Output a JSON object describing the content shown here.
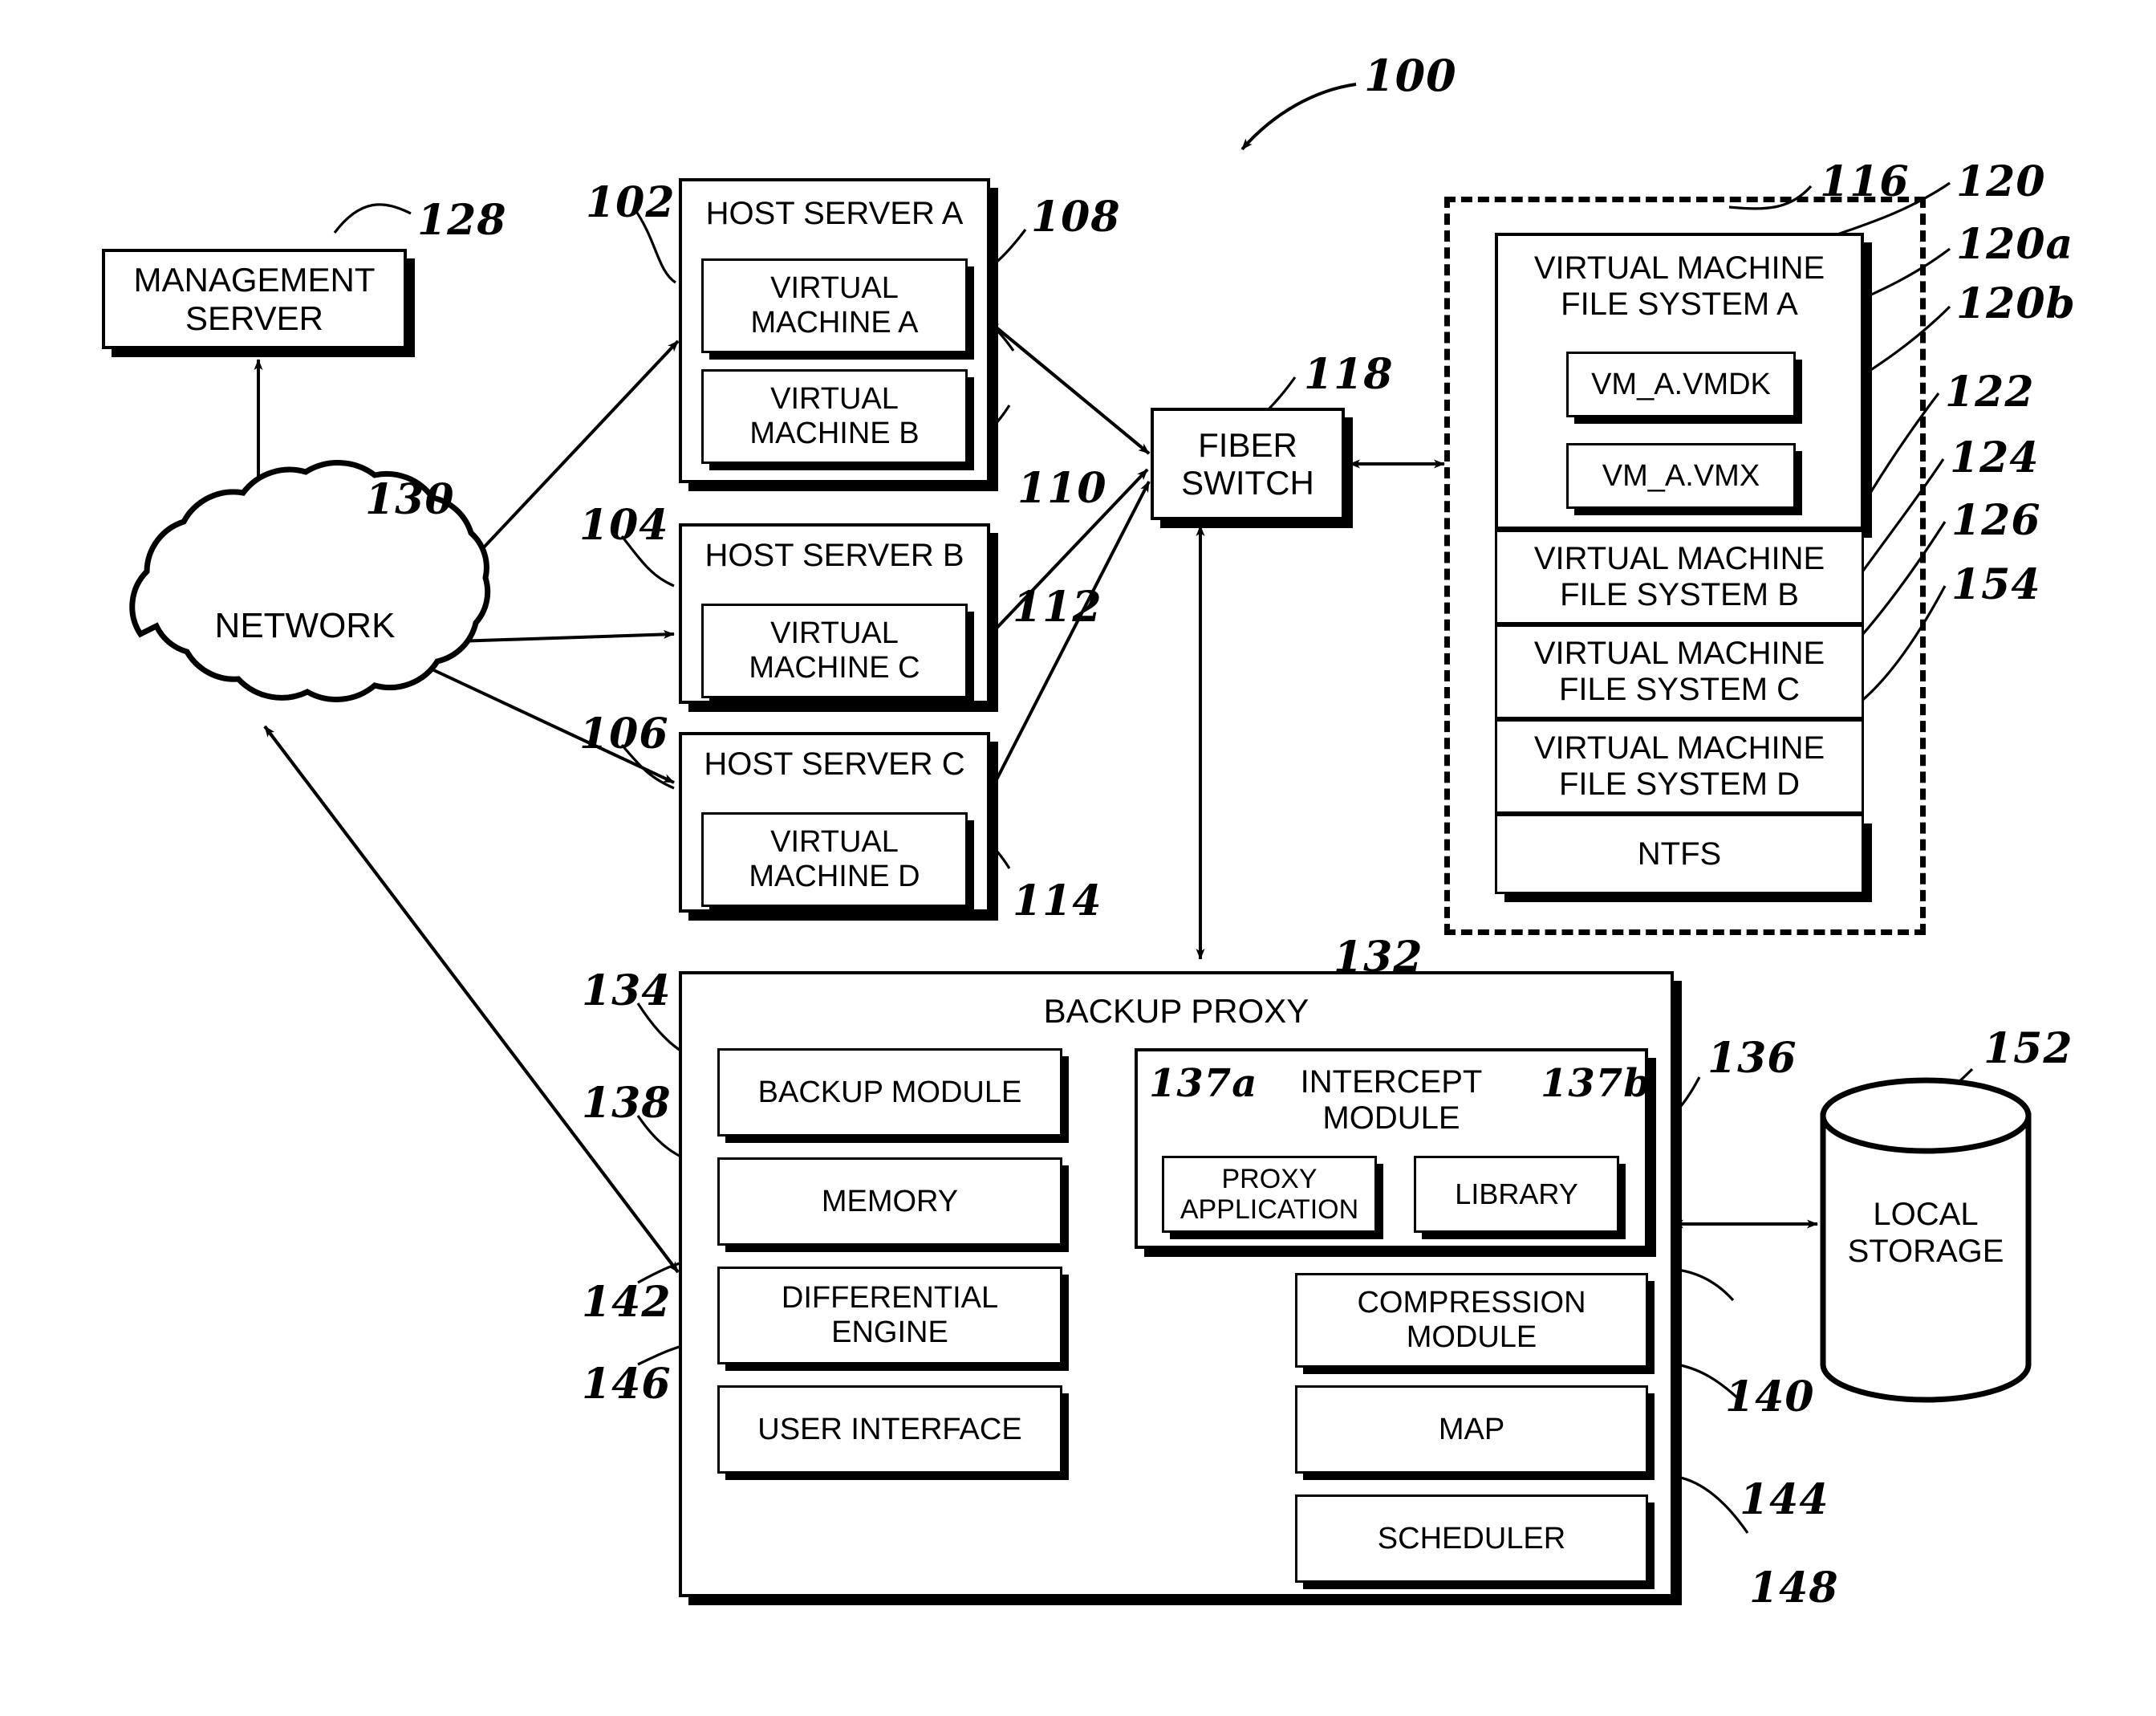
{
  "figure": {
    "number": "100",
    "type": "system-block-diagram"
  },
  "nodes": {
    "management_server": {
      "label": "MANAGEMENT\nSERVER",
      "ref": "128"
    },
    "network": {
      "label": "NETWORK",
      "ref": "130"
    },
    "host_server_a": {
      "label": "HOST SERVER A",
      "ref": "102"
    },
    "host_server_b": {
      "label": "HOST SERVER B",
      "ref": "104"
    },
    "host_server_c": {
      "label": "HOST SERVER C",
      "ref": "106"
    },
    "vm_a": {
      "label": "VIRTUAL\nMACHINE A",
      "ref": "108"
    },
    "vm_b": {
      "label": "VIRTUAL\nMACHINE B",
      "ref": "110"
    },
    "vm_c": {
      "label": "VIRTUAL\nMACHINE C",
      "ref": "112"
    },
    "vm_d": {
      "label": "VIRTUAL\nMACHINE D",
      "ref": "114"
    },
    "fiber_switch": {
      "label": "FIBER\nSWITCH",
      "ref": "118"
    },
    "storage_enclosure": {
      "ref": "116"
    },
    "vmfs_a": {
      "label": "VIRTUAL MACHINE\nFILE SYSTEM A",
      "ref": "120"
    },
    "vmdk_file": {
      "label": "VM_A.VMDK",
      "ref": "120a"
    },
    "vmx_file": {
      "label": "VM_A.VMX",
      "ref": "120b"
    },
    "vmfs_b": {
      "label": "VIRTUAL MACHINE\nFILE SYSTEM B",
      "ref": "122"
    },
    "vmfs_c": {
      "label": "VIRTUAL MACHINE\nFILE SYSTEM C",
      "ref": "124"
    },
    "vmfs_d": {
      "label": "VIRTUAL MACHINE\nFILE SYSTEM D",
      "ref": "126"
    },
    "ntfs": {
      "label": "NTFS",
      "ref": "154"
    },
    "backup_proxy": {
      "label": "BACKUP  PROXY",
      "ref": "132"
    },
    "backup_module": {
      "label": "BACKUP MODULE",
      "ref": "134"
    },
    "memory": {
      "label": "MEMORY",
      "ref": "138"
    },
    "differential_engine": {
      "label": "DIFFERENTIAL\nENGINE",
      "ref": "142"
    },
    "user_interface": {
      "label": "USER INTERFACE",
      "ref": "146"
    },
    "intercept_module": {
      "label": "INTERCEPT\nMODULE",
      "ref": "136"
    },
    "proxy_application": {
      "label": "PROXY\nAPPLICATION",
      "ref": "137a"
    },
    "library": {
      "label": "LIBRARY",
      "ref": "137b"
    },
    "compression_module": {
      "label": "COMPRESSION\nMODULE",
      "ref": "140"
    },
    "map": {
      "label": "MAP",
      "ref": "144"
    },
    "scheduler": {
      "label": "SCHEDULER",
      "ref": "148"
    },
    "local_storage": {
      "label": "LOCAL\nSTORAGE",
      "ref": "152"
    }
  },
  "colors": {
    "ink": "#000000",
    "paper": "#ffffff"
  }
}
